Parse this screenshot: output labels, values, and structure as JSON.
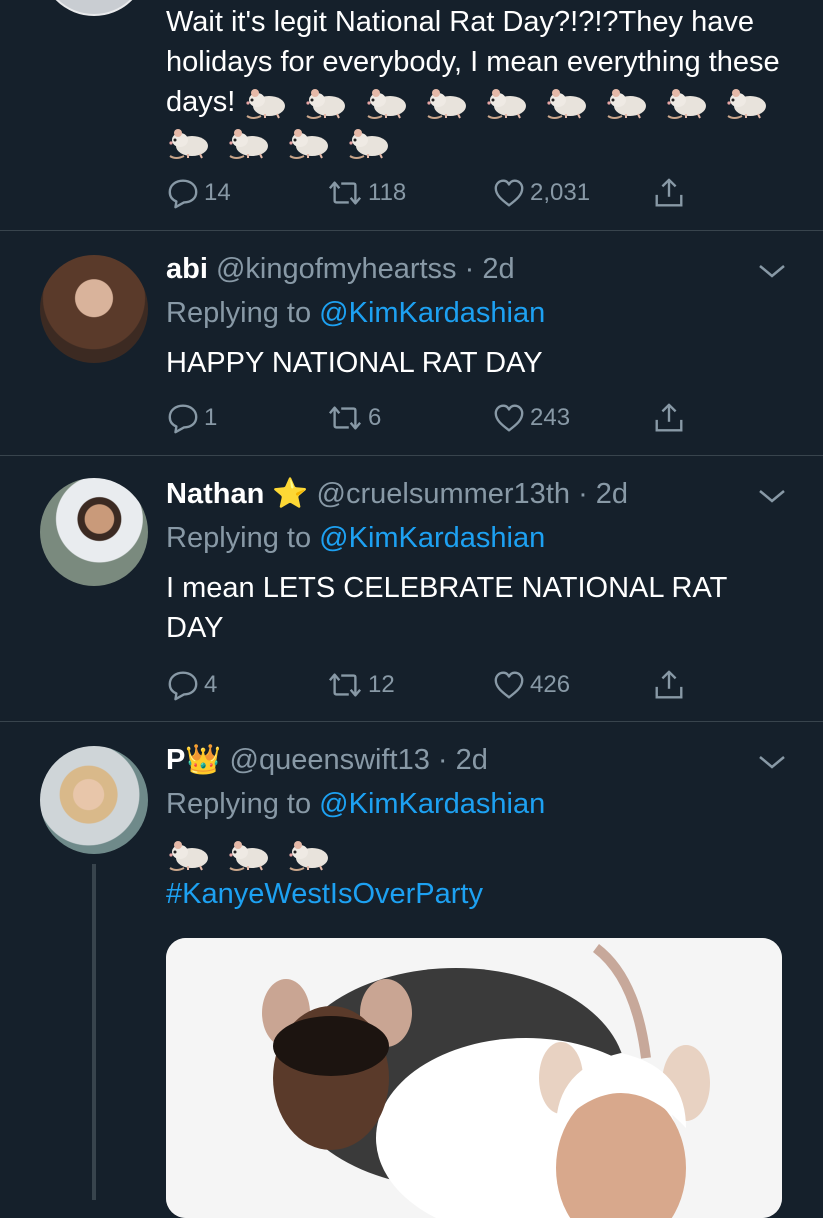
{
  "tweets": [
    {
      "text": "Wait it's legit National Rat Day?!?!?They have holidays for everybody, I mean everything these days!",
      "emoji_count": 13,
      "replies": "14",
      "retweets": "118",
      "likes": "2,031"
    },
    {
      "name": "abi",
      "handle": "@kingofmyheartss",
      "dot": "·",
      "time": "2d",
      "replying_prefix": "Replying to",
      "replying_to": "@KimKardashian",
      "text": "HAPPY NATIONAL RAT DAY",
      "replies": "1",
      "retweets": "6",
      "likes": "243"
    },
    {
      "name": "Nathan",
      "name_emoji": "⭐",
      "handle": "@cruelsummer13th",
      "dot": "·",
      "time": "2d",
      "replying_prefix": "Replying to",
      "replying_to": "@KimKardashian",
      "text": "I mean LETS CELEBRATE NATIONAL RAT DAY",
      "replies": "4",
      "retweets": "12",
      "likes": "426"
    },
    {
      "name": "P",
      "name_emoji": "👑",
      "handle": "@queenswift13",
      "dot": "·",
      "time": "2d",
      "replying_prefix": "Replying to",
      "replying_to": "@KimKardashian",
      "emoji_count": 3,
      "hashtag": "#KanyeWestIsOverParty"
    }
  ],
  "colors": {
    "background": "#15202b",
    "divider": "#38444d",
    "secondary_text": "#8899a6",
    "link": "#1da1f2"
  },
  "icons": [
    "reply-icon",
    "retweet-icon",
    "like-icon",
    "share-icon",
    "chevron-down-icon",
    "rat-emoji"
  ]
}
